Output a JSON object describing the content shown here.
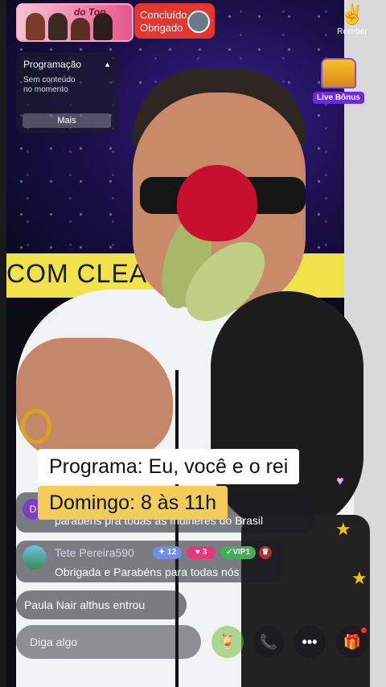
{
  "top": {
    "card_title": "do Top",
    "concluido_line1": "Concluído",
    "concluido_line2": "Obrigado",
    "receber_label": "Receber",
    "receber_icon": "v-bunny-icon"
  },
  "programacao": {
    "title": "Programação",
    "empty_line1": "Sem conteúdo",
    "empty_line2": "no momento",
    "more_label": "Mais"
  },
  "live_bonus": {
    "label": "Live Bônus"
  },
  "scene": {
    "banner_text": "COM CLEA   NEIRO"
  },
  "captions": {
    "line1": "Programa: Eu, você e o rei",
    "line2": "Domingo: 8 às 11h"
  },
  "comments": [
    {
      "avatar_letter": "D",
      "text": "parabéns pra todas as mulheres do Brasil"
    },
    {
      "name": "Tete Pereira590",
      "level": "12",
      "heart_level": "3",
      "vip": "VIP1",
      "text": "Obrigada e Parabéns para todas nós"
    },
    {
      "text": "Paula Nair althus  entrou"
    }
  ],
  "input": {
    "placeholder": "Diga algo"
  },
  "actions": {
    "more_icon": "•••"
  },
  "colors": {
    "accent_red": "#e5352f",
    "caption_yellow": "#f2cd5a",
    "bonus_purple": "#6b2bd9"
  }
}
